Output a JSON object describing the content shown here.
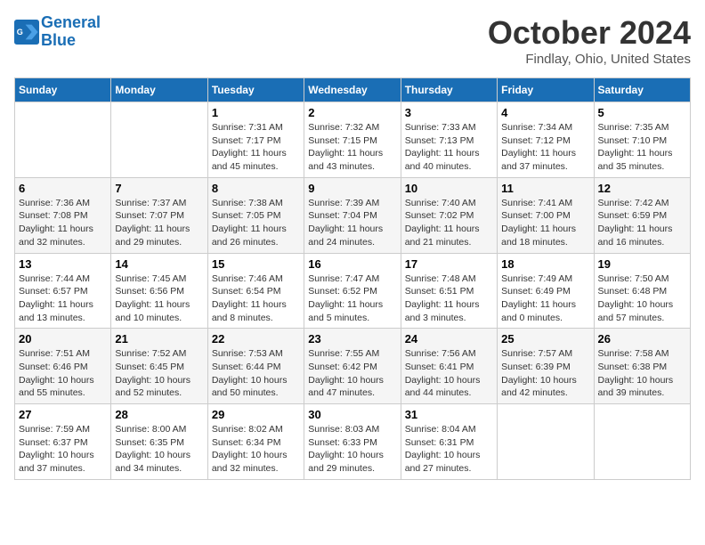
{
  "header": {
    "logo_line1": "General",
    "logo_line2": "Blue",
    "title": "October 2024",
    "location": "Findlay, Ohio, United States"
  },
  "columns": [
    "Sunday",
    "Monday",
    "Tuesday",
    "Wednesday",
    "Thursday",
    "Friday",
    "Saturday"
  ],
  "weeks": [
    [
      {
        "day": "",
        "detail": ""
      },
      {
        "day": "",
        "detail": ""
      },
      {
        "day": "1",
        "detail": "Sunrise: 7:31 AM\nSunset: 7:17 PM\nDaylight: 11 hours and 45 minutes."
      },
      {
        "day": "2",
        "detail": "Sunrise: 7:32 AM\nSunset: 7:15 PM\nDaylight: 11 hours and 43 minutes."
      },
      {
        "day": "3",
        "detail": "Sunrise: 7:33 AM\nSunset: 7:13 PM\nDaylight: 11 hours and 40 minutes."
      },
      {
        "day": "4",
        "detail": "Sunrise: 7:34 AM\nSunset: 7:12 PM\nDaylight: 11 hours and 37 minutes."
      },
      {
        "day": "5",
        "detail": "Sunrise: 7:35 AM\nSunset: 7:10 PM\nDaylight: 11 hours and 35 minutes."
      }
    ],
    [
      {
        "day": "6",
        "detail": "Sunrise: 7:36 AM\nSunset: 7:08 PM\nDaylight: 11 hours and 32 minutes."
      },
      {
        "day": "7",
        "detail": "Sunrise: 7:37 AM\nSunset: 7:07 PM\nDaylight: 11 hours and 29 minutes."
      },
      {
        "day": "8",
        "detail": "Sunrise: 7:38 AM\nSunset: 7:05 PM\nDaylight: 11 hours and 26 minutes."
      },
      {
        "day": "9",
        "detail": "Sunrise: 7:39 AM\nSunset: 7:04 PM\nDaylight: 11 hours and 24 minutes."
      },
      {
        "day": "10",
        "detail": "Sunrise: 7:40 AM\nSunset: 7:02 PM\nDaylight: 11 hours and 21 minutes."
      },
      {
        "day": "11",
        "detail": "Sunrise: 7:41 AM\nSunset: 7:00 PM\nDaylight: 11 hours and 18 minutes."
      },
      {
        "day": "12",
        "detail": "Sunrise: 7:42 AM\nSunset: 6:59 PM\nDaylight: 11 hours and 16 minutes."
      }
    ],
    [
      {
        "day": "13",
        "detail": "Sunrise: 7:44 AM\nSunset: 6:57 PM\nDaylight: 11 hours and 13 minutes."
      },
      {
        "day": "14",
        "detail": "Sunrise: 7:45 AM\nSunset: 6:56 PM\nDaylight: 11 hours and 10 minutes."
      },
      {
        "day": "15",
        "detail": "Sunrise: 7:46 AM\nSunset: 6:54 PM\nDaylight: 11 hours and 8 minutes."
      },
      {
        "day": "16",
        "detail": "Sunrise: 7:47 AM\nSunset: 6:52 PM\nDaylight: 11 hours and 5 minutes."
      },
      {
        "day": "17",
        "detail": "Sunrise: 7:48 AM\nSunset: 6:51 PM\nDaylight: 11 hours and 3 minutes."
      },
      {
        "day": "18",
        "detail": "Sunrise: 7:49 AM\nSunset: 6:49 PM\nDaylight: 11 hours and 0 minutes."
      },
      {
        "day": "19",
        "detail": "Sunrise: 7:50 AM\nSunset: 6:48 PM\nDaylight: 10 hours and 57 minutes."
      }
    ],
    [
      {
        "day": "20",
        "detail": "Sunrise: 7:51 AM\nSunset: 6:46 PM\nDaylight: 10 hours and 55 minutes."
      },
      {
        "day": "21",
        "detail": "Sunrise: 7:52 AM\nSunset: 6:45 PM\nDaylight: 10 hours and 52 minutes."
      },
      {
        "day": "22",
        "detail": "Sunrise: 7:53 AM\nSunset: 6:44 PM\nDaylight: 10 hours and 50 minutes."
      },
      {
        "day": "23",
        "detail": "Sunrise: 7:55 AM\nSunset: 6:42 PM\nDaylight: 10 hours and 47 minutes."
      },
      {
        "day": "24",
        "detail": "Sunrise: 7:56 AM\nSunset: 6:41 PM\nDaylight: 10 hours and 44 minutes."
      },
      {
        "day": "25",
        "detail": "Sunrise: 7:57 AM\nSunset: 6:39 PM\nDaylight: 10 hours and 42 minutes."
      },
      {
        "day": "26",
        "detail": "Sunrise: 7:58 AM\nSunset: 6:38 PM\nDaylight: 10 hours and 39 minutes."
      }
    ],
    [
      {
        "day": "27",
        "detail": "Sunrise: 7:59 AM\nSunset: 6:37 PM\nDaylight: 10 hours and 37 minutes."
      },
      {
        "day": "28",
        "detail": "Sunrise: 8:00 AM\nSunset: 6:35 PM\nDaylight: 10 hours and 34 minutes."
      },
      {
        "day": "29",
        "detail": "Sunrise: 8:02 AM\nSunset: 6:34 PM\nDaylight: 10 hours and 32 minutes."
      },
      {
        "day": "30",
        "detail": "Sunrise: 8:03 AM\nSunset: 6:33 PM\nDaylight: 10 hours and 29 minutes."
      },
      {
        "day": "31",
        "detail": "Sunrise: 8:04 AM\nSunset: 6:31 PM\nDaylight: 10 hours and 27 minutes."
      },
      {
        "day": "",
        "detail": ""
      },
      {
        "day": "",
        "detail": ""
      }
    ]
  ]
}
